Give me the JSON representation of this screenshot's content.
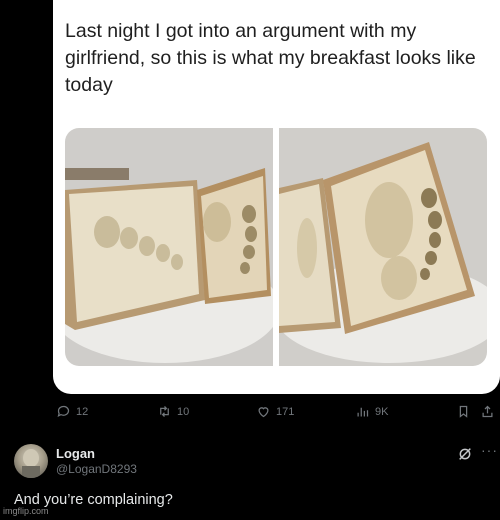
{
  "tweet": {
    "text": "Last night I got into an argument with my girlfriend, so this is what my breakfast looks like today"
  },
  "actions": {
    "replies": "12",
    "reposts": "10",
    "likes": "171",
    "views": "9K"
  },
  "reply": {
    "name": "Logan",
    "handle": "@LoganD8293",
    "text": "And you’re complaining?"
  },
  "watermark": "imgflip.com",
  "colors": {
    "background": "#000000",
    "card": "#ffffff",
    "muted": "#71767b",
    "text_light": "#e7e9ea"
  }
}
